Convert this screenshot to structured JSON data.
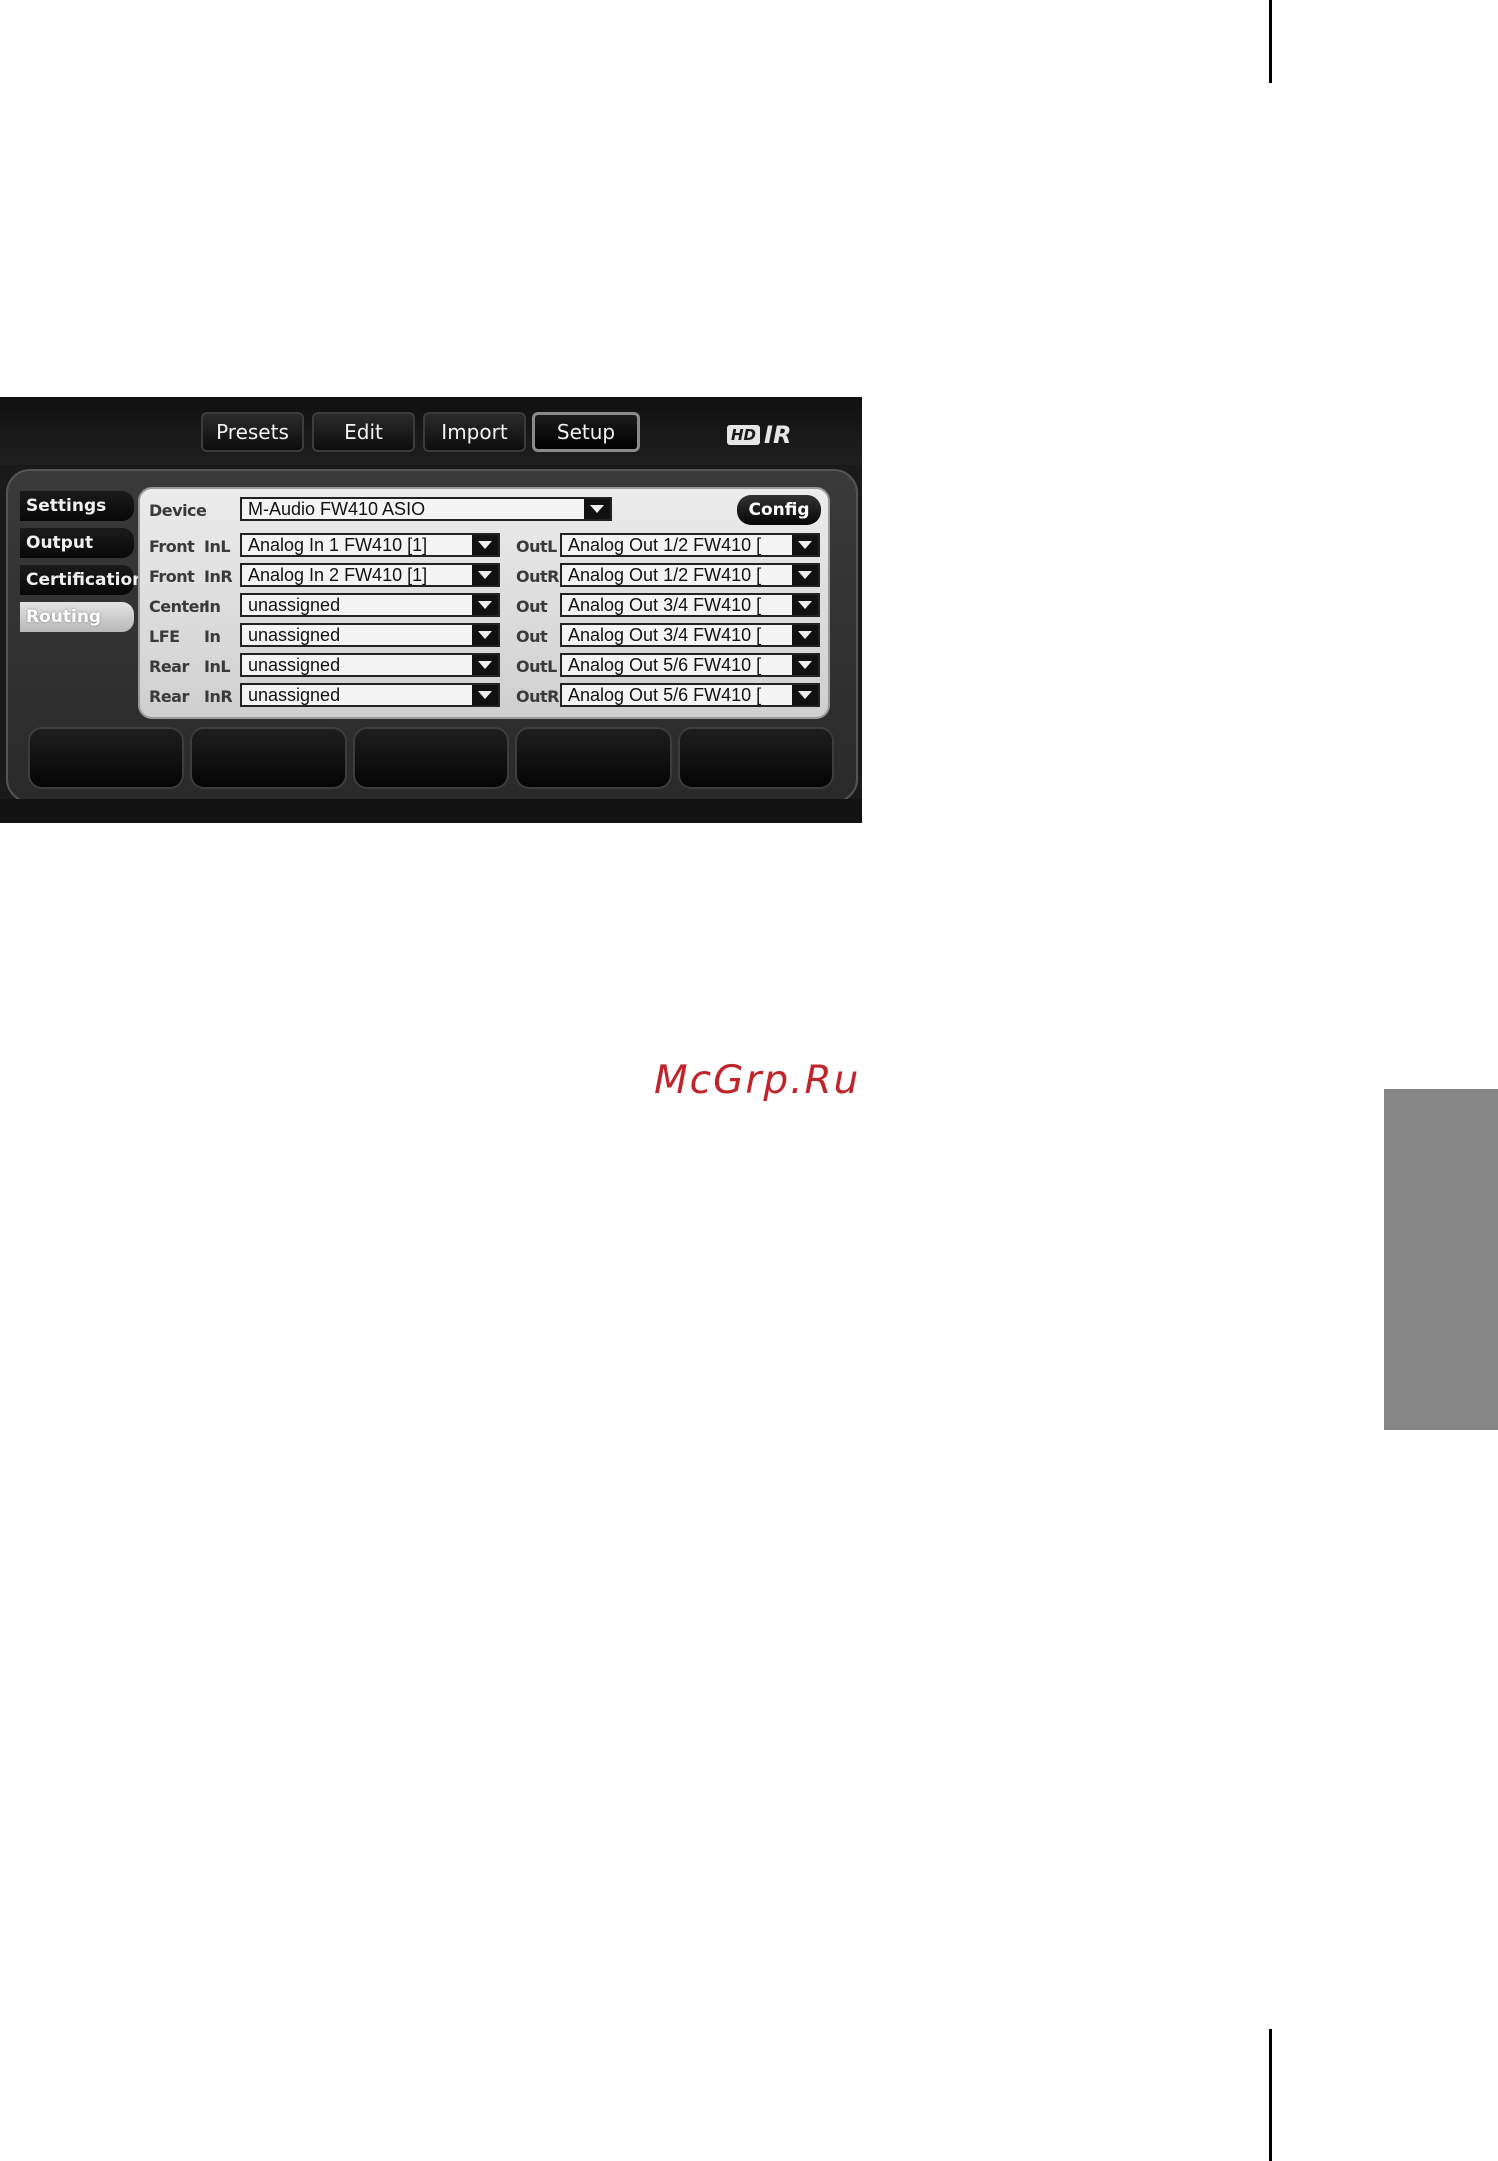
{
  "top_tabs": [
    "Presets",
    "Edit",
    "Import",
    "Setup"
  ],
  "logo": {
    "hd": "HD",
    "ir": "IR"
  },
  "side_nav": [
    "Settings",
    "Output",
    "Certification",
    "Routing"
  ],
  "device": {
    "label": "Device",
    "value": "M-Audio FW410 ASIO",
    "config_label": "Config"
  },
  "routing_rows": [
    {
      "group": "Front",
      "in_label": "InL",
      "in_value": "Analog In 1 FW410 [1]",
      "out_label": "OutL",
      "out_value": "Analog Out 1/2 FW410 ["
    },
    {
      "group": "Front",
      "in_label": "InR",
      "in_value": "Analog In 2 FW410 [1]",
      "out_label": "OutR",
      "out_value": "Analog Out 1/2 FW410 ["
    },
    {
      "group": "Center",
      "in_label": "In",
      "in_value": "unassigned",
      "out_label": "Out",
      "out_value": "Analog Out 3/4 FW410 ["
    },
    {
      "group": "LFE",
      "in_label": "In",
      "in_value": "unassigned",
      "out_label": "Out",
      "out_value": "Analog Out 3/4 FW410 ["
    },
    {
      "group": "Rear",
      "in_label": "InL",
      "in_value": "unassigned",
      "out_label": "OutL",
      "out_value": "Analog Out 5/6 FW410 ["
    },
    {
      "group": "Rear",
      "in_label": "InR",
      "in_value": "unassigned",
      "out_label": "OutR",
      "out_value": "Analog Out 5/6 FW410 ["
    }
  ],
  "watermark": "McGrp.Ru",
  "colors": {
    "watermark": "#c0252b",
    "side_tab": "#858585",
    "active_nav": "#d0d0d0"
  }
}
